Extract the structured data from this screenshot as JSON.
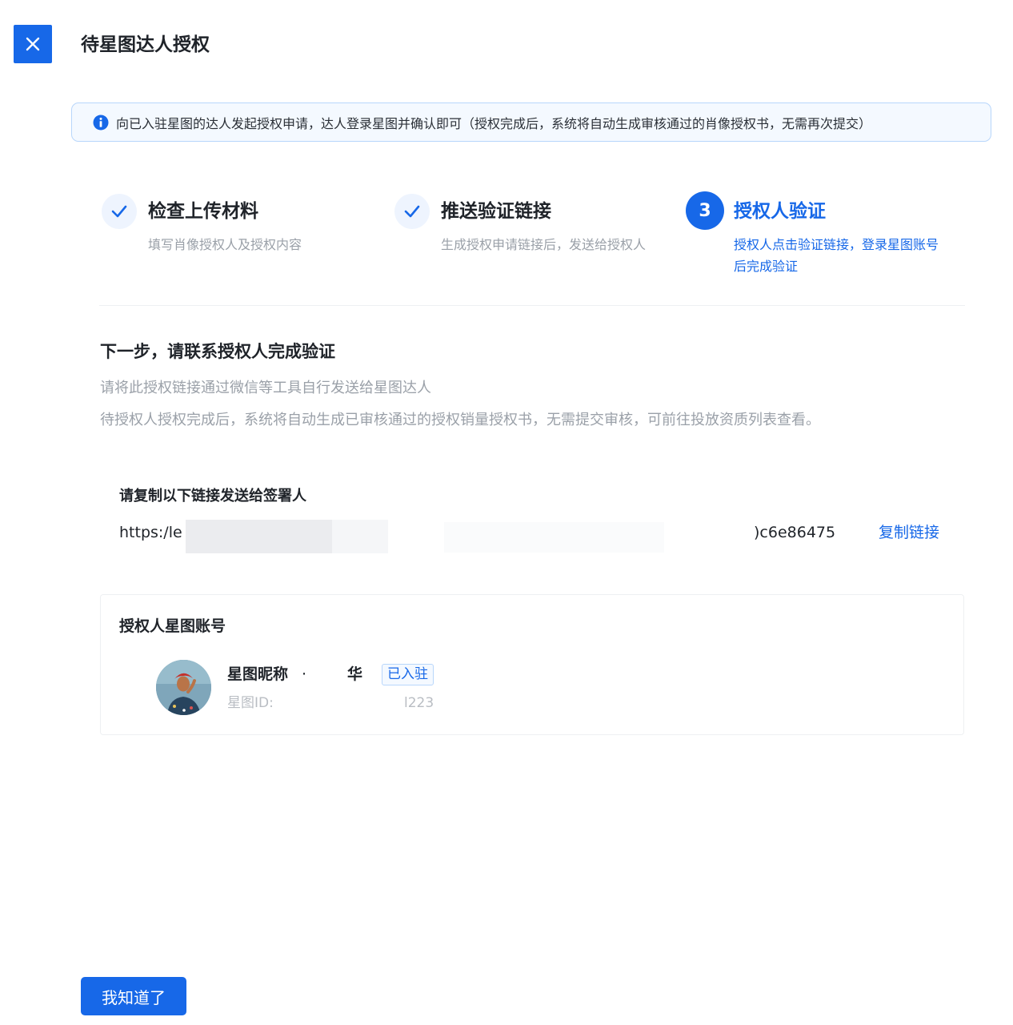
{
  "header": {
    "title": "待星图达人授权",
    "close_icon": "close-icon"
  },
  "banner": {
    "icon": "info-icon",
    "text": "向已入驻星图的达人发起授权申请，达人登录星图并确认即可（授权完成后，系统将自动生成审核通过的肖像授权书，无需再次提交）"
  },
  "steps": [
    {
      "status": "done",
      "title": "检查上传材料",
      "desc": "填写肖像授权人及授权内容"
    },
    {
      "status": "done",
      "title": "推送验证链接",
      "desc": "生成授权申请链接后，发送给授权人"
    },
    {
      "status": "active",
      "number": "3",
      "title": "授权人验证",
      "desc_line1": "授权人点击验证链接，登录星图账号",
      "desc_line2": "后完成验证"
    }
  ],
  "next": {
    "title": "下一步，请联系授权人完成验证",
    "line1": "请将此授权链接通过微信等工具自行发送给星图达人",
    "line2": "待授权人授权完成后，系统将自动生成已审核通过的授权销量授权书，无需提交审核，可前往投放资质列表查看。"
  },
  "link": {
    "label": "请复制以下链接发送给签署人",
    "prefix": "https:/le",
    "suffix": ")c6e86475",
    "copy_label": "复制链接"
  },
  "account": {
    "title": "授权人星图账号",
    "nickname": "星图昵称",
    "nickname_sep": "·",
    "nickname_end": "华",
    "badge": "已入驻",
    "uid_prefix": "星图ID: 53",
    "uid_suffix": "l223"
  },
  "ok_button": "我知道了",
  "colors": {
    "primary": "#1768e8",
    "banner_bg": "#f4f9ff",
    "muted_text": "#9aa0a8"
  }
}
